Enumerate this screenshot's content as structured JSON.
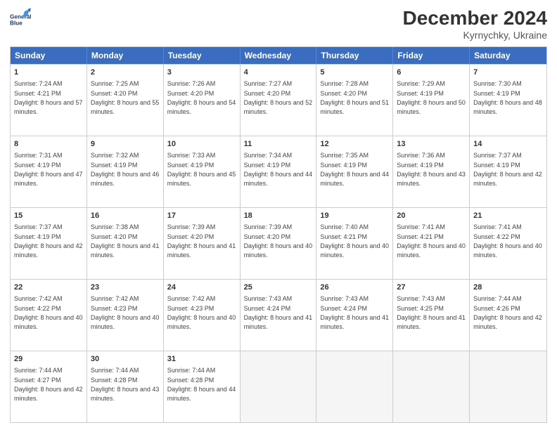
{
  "header": {
    "logo_line1": "General",
    "logo_line2": "Blue",
    "month": "December 2024",
    "location": "Kyrnychky, Ukraine"
  },
  "weekdays": [
    "Sunday",
    "Monday",
    "Tuesday",
    "Wednesday",
    "Thursday",
    "Friday",
    "Saturday"
  ],
  "weeks": [
    [
      {
        "day": "1",
        "rise": "7:24 AM",
        "set": "4:21 PM",
        "daylight": "8 hours and 57 minutes."
      },
      {
        "day": "2",
        "rise": "7:25 AM",
        "set": "4:20 PM",
        "daylight": "8 hours and 55 minutes."
      },
      {
        "day": "3",
        "rise": "7:26 AM",
        "set": "4:20 PM",
        "daylight": "8 hours and 54 minutes."
      },
      {
        "day": "4",
        "rise": "7:27 AM",
        "set": "4:20 PM",
        "daylight": "8 hours and 52 minutes."
      },
      {
        "day": "5",
        "rise": "7:28 AM",
        "set": "4:20 PM",
        "daylight": "8 hours and 51 minutes."
      },
      {
        "day": "6",
        "rise": "7:29 AM",
        "set": "4:19 PM",
        "daylight": "8 hours and 50 minutes."
      },
      {
        "day": "7",
        "rise": "7:30 AM",
        "set": "4:19 PM",
        "daylight": "8 hours and 48 minutes."
      }
    ],
    [
      {
        "day": "8",
        "rise": "7:31 AM",
        "set": "4:19 PM",
        "daylight": "8 hours and 47 minutes."
      },
      {
        "day": "9",
        "rise": "7:32 AM",
        "set": "4:19 PM",
        "daylight": "8 hours and 46 minutes."
      },
      {
        "day": "10",
        "rise": "7:33 AM",
        "set": "4:19 PM",
        "daylight": "8 hours and 45 minutes."
      },
      {
        "day": "11",
        "rise": "7:34 AM",
        "set": "4:19 PM",
        "daylight": "8 hours and 44 minutes."
      },
      {
        "day": "12",
        "rise": "7:35 AM",
        "set": "4:19 PM",
        "daylight": "8 hours and 44 minutes."
      },
      {
        "day": "13",
        "rise": "7:36 AM",
        "set": "4:19 PM",
        "daylight": "8 hours and 43 minutes."
      },
      {
        "day": "14",
        "rise": "7:37 AM",
        "set": "4:19 PM",
        "daylight": "8 hours and 42 minutes."
      }
    ],
    [
      {
        "day": "15",
        "rise": "7:37 AM",
        "set": "4:19 PM",
        "daylight": "8 hours and 42 minutes."
      },
      {
        "day": "16",
        "rise": "7:38 AM",
        "set": "4:20 PM",
        "daylight": "8 hours and 41 minutes."
      },
      {
        "day": "17",
        "rise": "7:39 AM",
        "set": "4:20 PM",
        "daylight": "8 hours and 41 minutes."
      },
      {
        "day": "18",
        "rise": "7:39 AM",
        "set": "4:20 PM",
        "daylight": "8 hours and 40 minutes."
      },
      {
        "day": "19",
        "rise": "7:40 AM",
        "set": "4:21 PM",
        "daylight": "8 hours and 40 minutes."
      },
      {
        "day": "20",
        "rise": "7:41 AM",
        "set": "4:21 PM",
        "daylight": "8 hours and 40 minutes."
      },
      {
        "day": "21",
        "rise": "7:41 AM",
        "set": "4:22 PM",
        "daylight": "8 hours and 40 minutes."
      }
    ],
    [
      {
        "day": "22",
        "rise": "7:42 AM",
        "set": "4:22 PM",
        "daylight": "8 hours and 40 minutes."
      },
      {
        "day": "23",
        "rise": "7:42 AM",
        "set": "4:23 PM",
        "daylight": "8 hours and 40 minutes."
      },
      {
        "day": "24",
        "rise": "7:42 AM",
        "set": "4:23 PM",
        "daylight": "8 hours and 40 minutes."
      },
      {
        "day": "25",
        "rise": "7:43 AM",
        "set": "4:24 PM",
        "daylight": "8 hours and 41 minutes."
      },
      {
        "day": "26",
        "rise": "7:43 AM",
        "set": "4:24 PM",
        "daylight": "8 hours and 41 minutes."
      },
      {
        "day": "27",
        "rise": "7:43 AM",
        "set": "4:25 PM",
        "daylight": "8 hours and 41 minutes."
      },
      {
        "day": "28",
        "rise": "7:44 AM",
        "set": "4:26 PM",
        "daylight": "8 hours and 42 minutes."
      }
    ],
    [
      {
        "day": "29",
        "rise": "7:44 AM",
        "set": "4:27 PM",
        "daylight": "8 hours and 42 minutes."
      },
      {
        "day": "30",
        "rise": "7:44 AM",
        "set": "4:28 PM",
        "daylight": "8 hours and 43 minutes."
      },
      {
        "day": "31",
        "rise": "7:44 AM",
        "set": "4:28 PM",
        "daylight": "8 hours and 44 minutes."
      },
      null,
      null,
      null,
      null
    ]
  ]
}
